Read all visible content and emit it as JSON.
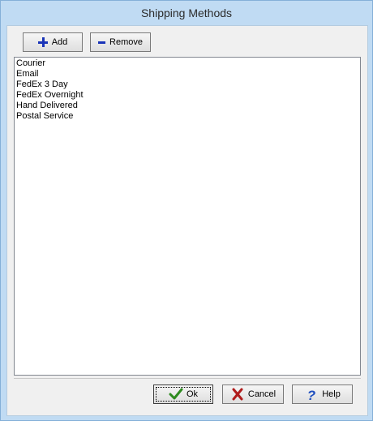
{
  "window": {
    "title": "Shipping Methods"
  },
  "toolbar": {
    "add_label": "Add",
    "remove_label": "Remove"
  },
  "list": {
    "items": [
      "Courier",
      "Email",
      "FedEx 3 Day",
      "FedEx Overnight",
      "Hand Delivered",
      "Postal Service"
    ]
  },
  "footer": {
    "ok_label": "Ok",
    "cancel_label": "Cancel",
    "help_label": "Help"
  },
  "colors": {
    "accent": "#1a34b8",
    "check": "#2e8b1f",
    "cancel_x": "#b01c1c",
    "help": "#1f4fbf"
  }
}
